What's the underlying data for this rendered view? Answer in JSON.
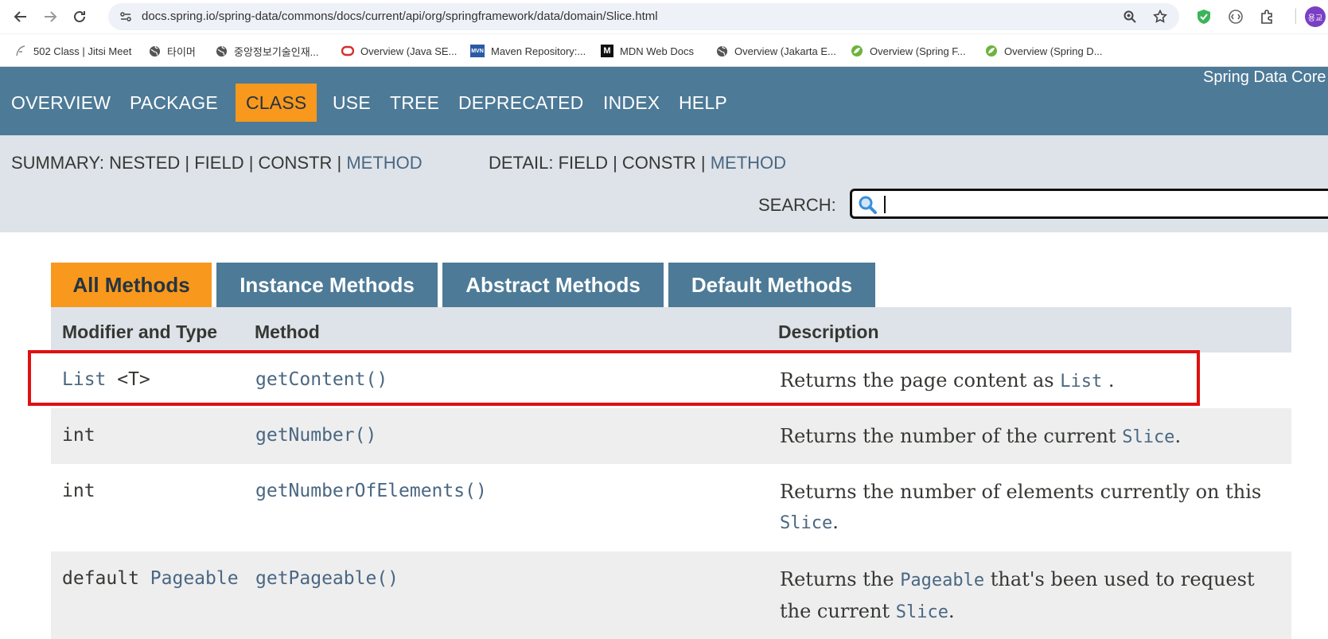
{
  "browser": {
    "url": "docs.spring.io/spring-data/commons/docs/current/api/org/springframework/data/domain/Slice.html",
    "profile_initials": "용교"
  },
  "bookmarks": [
    {
      "label": "502 Class | Jitsi Meet",
      "icon": "feather-icon"
    },
    {
      "label": "타이머",
      "icon": "globe-icon"
    },
    {
      "label": "중앙정보기술인재...",
      "icon": "globe-icon"
    },
    {
      "label": "Overview (Java SE...",
      "icon": "oracle-icon"
    },
    {
      "label": "Maven Repository:...",
      "icon": "mvn-icon"
    },
    {
      "label": "MDN Web Docs",
      "icon": "mdn-icon"
    },
    {
      "label": "Overview (Jakarta E...",
      "icon": "globe-icon"
    },
    {
      "label": "Overview (Spring F...",
      "icon": "spring-icon"
    },
    {
      "label": "Overview (Spring D...",
      "icon": "spring-icon"
    }
  ],
  "topnav": {
    "items": [
      "OVERVIEW",
      "PACKAGE",
      "CLASS",
      "USE",
      "TREE",
      "DEPRECATED",
      "INDEX",
      "HELP"
    ],
    "active": "CLASS",
    "project_title": "Spring Data Core"
  },
  "subnav": {
    "summary_prefix": "SUMMARY: NESTED | FIELD | CONSTR | ",
    "summary_link": "METHOD",
    "detail_prefix": "DETAIL: FIELD | CONSTR | ",
    "detail_link": "METHOD",
    "search_label": "SEARCH:"
  },
  "method_tabs": [
    "All Methods",
    "Instance Methods",
    "Abstract Methods",
    "Default Methods"
  ],
  "table": {
    "headers": [
      "Modifier and Type",
      "Method",
      "Description"
    ],
    "rows": [
      {
        "type_link": "List",
        "type_suffix": " <T>",
        "method": "getContent()",
        "desc_prefix": "Returns the page content as ",
        "desc_code": "List",
        "desc_suffix": " ."
      },
      {
        "type": "int",
        "method": "getNumber()",
        "desc_prefix": "Returns the number of the current ",
        "desc_code": "Slice",
        "desc_suffix": "."
      },
      {
        "type": "int",
        "method": "getNumberOfElements()",
        "desc_prefix": "Returns the number of elements currently on this ",
        "desc_code": "Slice",
        "desc_suffix": "."
      },
      {
        "type": "default ",
        "type_link": "Pageable",
        "method": "getPageable()",
        "desc_prefix": "Returns the ",
        "desc_code": "Pageable",
        "desc_mid": " that's been used to request the current ",
        "desc_code2": "Slice",
        "desc_suffix": "."
      }
    ]
  },
  "colors": {
    "nav_blue": "#4d7a97",
    "active_orange": "#f8981d",
    "subnav_gray": "#dee3e9",
    "link_blue": "#4a6782",
    "highlight_red": "#e01010"
  }
}
